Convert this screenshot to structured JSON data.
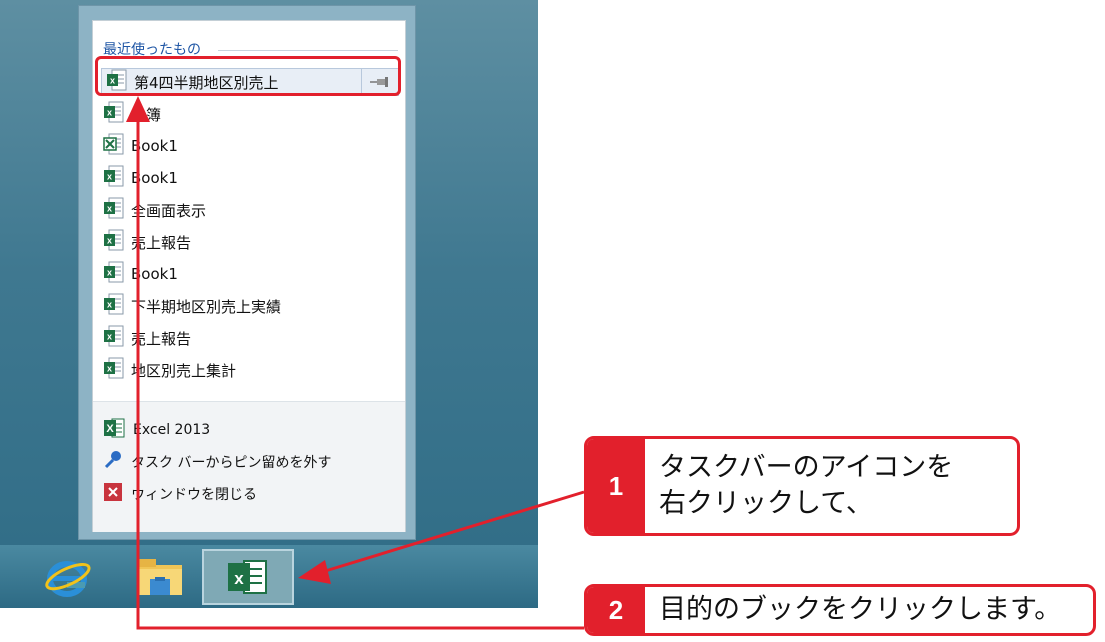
{
  "jumplist": {
    "section_title": "最近使ったもの",
    "recent_items": [
      {
        "label": "第4四半期地区別売上",
        "icon": "excel-file-icon"
      },
      {
        "label": "名簿",
        "icon": "excel-file-icon"
      },
      {
        "label": "Book1",
        "icon": "excel-csv-file-icon"
      },
      {
        "label": "Book1",
        "icon": "excel-file-icon"
      },
      {
        "label": "全画面表示",
        "icon": "excel-file-icon"
      },
      {
        "label": "売上報告",
        "icon": "excel-file-icon"
      },
      {
        "label": "Book1",
        "icon": "excel-file-icon"
      },
      {
        "label": "下半期地区別売上実績",
        "icon": "excel-file-icon"
      },
      {
        "label": "売上報告",
        "icon": "excel-file-icon"
      },
      {
        "label": "地区別売上集計",
        "icon": "excel-file-icon"
      }
    ],
    "tasks": [
      {
        "label": "Excel 2013",
        "icon": "excel-app-icon"
      },
      {
        "label": "タスク バーからピン留めを外す",
        "icon": "unpin-icon"
      },
      {
        "label": "ウィンドウを閉じる",
        "icon": "close-window-icon"
      }
    ]
  },
  "taskbar": {
    "items": [
      "internet-explorer-icon",
      "file-explorer-icon",
      "excel-taskbar-icon"
    ]
  },
  "callouts": [
    {
      "number": "1",
      "lines": [
        "タスクバーのアイコンを",
        "右クリックして、"
      ]
    },
    {
      "number": "2",
      "lines": [
        "目的のブックをクリックします。"
      ]
    }
  ],
  "colors": {
    "accent_red": "#e2202c",
    "excel_green": "#1e7145",
    "link_blue": "#1f56a5"
  }
}
